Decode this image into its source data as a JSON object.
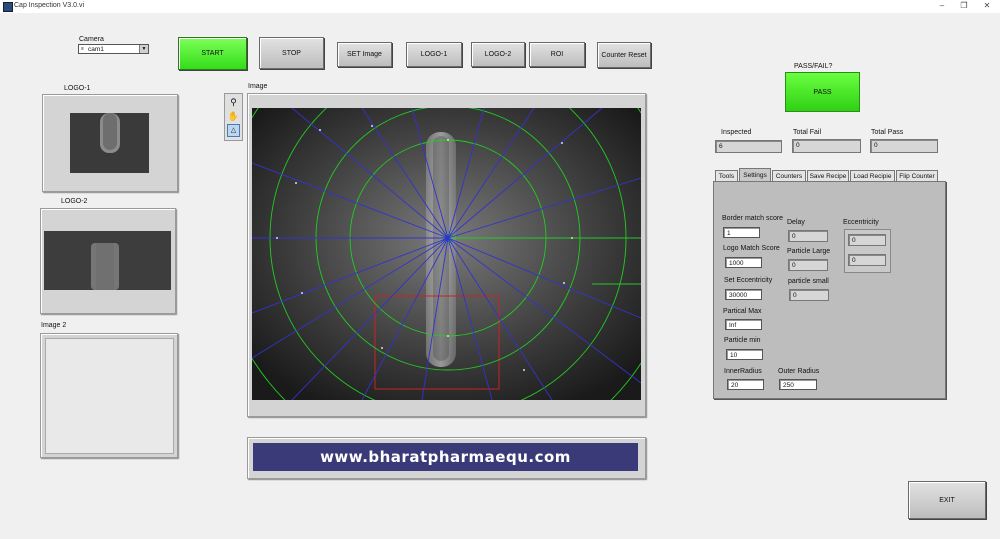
{
  "window": {
    "title": "Cap Inspection V3.0.vi"
  },
  "camera": {
    "label": "Camera",
    "value": "cam1"
  },
  "toolbar": {
    "start": "START",
    "stop": "STOP",
    "set_image": "SET Image",
    "logo1": "LOGO-1",
    "logo2": "LOGO-2",
    "roi": "ROI",
    "counter_reset": "Counter Reset"
  },
  "panels": {
    "logo1_label": "LOGO-1",
    "logo2_label": "LOGO-2",
    "image2_label": "Image 2",
    "image_label": "Image"
  },
  "passfail": {
    "label": "PASS/FAIL?",
    "value": "PASS"
  },
  "counters": {
    "inspected_label": "Inspected",
    "inspected": "6",
    "total_fail_label": "Total Fail",
    "total_fail": "0",
    "total_pass_label": "Total Pass",
    "total_pass": "0"
  },
  "tabs": [
    "Tools",
    "Settings",
    "Counters",
    "Save Recipe",
    "Load Recipie",
    "Flip Counter"
  ],
  "active_tab": "Settings",
  "settings": {
    "border_match_label": "Border match score",
    "border_match": "1",
    "logo_match_label": "Logo Match Score",
    "logo_match": "1000",
    "set_ecc_label": "Set Eccentricity",
    "set_ecc": "30000",
    "particle_max_label": "Partical  Max",
    "particle_max": "Inf",
    "particle_min_label": "Particle min",
    "particle_min": "10",
    "inner_radius_label": "InnerRadius",
    "inner_radius": "20",
    "outer_radius_label": "Outer Radius",
    "outer_radius": "250",
    "delay_label": "Delay",
    "delay": "0",
    "particle_large_label": "Particle Large",
    "particle_large": "0",
    "particle_small_label": "particle small",
    "particle_small": "0",
    "ecc_label": "Eccentricity",
    "ecc1": "0",
    "ecc2": "0"
  },
  "banner": {
    "text": "www.bharatpharmaequ.com"
  },
  "exit": "EXIT",
  "colors": {
    "green": "#33dd18",
    "banner_bg": "#3a3a78",
    "overlay_green": "#22cc22",
    "overlay_blue": "#3333cc",
    "roi_red": "#cc2222"
  }
}
